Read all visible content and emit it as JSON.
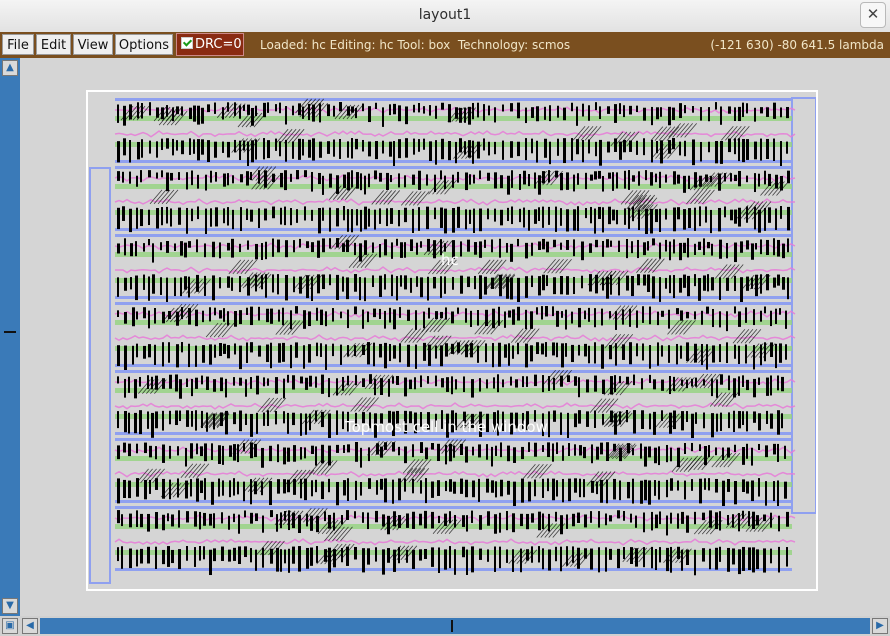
{
  "window": {
    "title": "layout1",
    "close_glyph": "✕"
  },
  "menu": [
    {
      "label": "File"
    },
    {
      "label": "Edit"
    },
    {
      "label": "View"
    },
    {
      "label": "Options"
    }
  ],
  "drc": {
    "label": "DRC=0",
    "checked": true
  },
  "status_text": "Loaded: hc Editing: hc Tool: box  Technology: scmos",
  "coordinates": "(-121 630) -80 641.5 lambda",
  "canvas": {
    "cell_name": "hc",
    "overlay_label": "Topmost cell in the window",
    "colors": {
      "background": "#d5d5d5",
      "metal1": "#8fa0f0",
      "poly": "#e87ad8",
      "diffusion": "#93d37e",
      "contact": "#000000",
      "outline": "#ffffff"
    }
  },
  "scroll_icons": {
    "up": "up-arrow-icon",
    "down": "down-arrow-icon",
    "left": "left-arrow-icon",
    "right": "right-arrow-icon",
    "zoom": "zoom-box-icon"
  }
}
